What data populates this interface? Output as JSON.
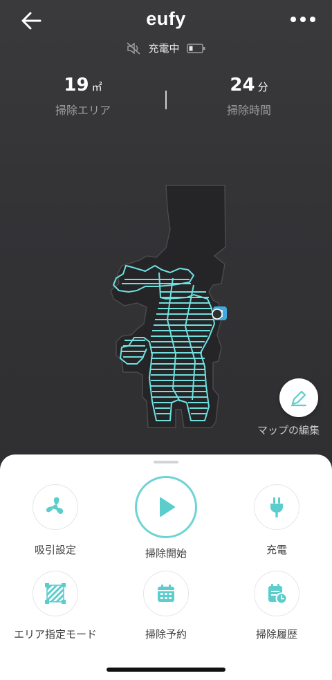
{
  "header": {
    "brand": "eufy",
    "status_text": "充電中"
  },
  "stats": {
    "area": {
      "value": "19",
      "unit": "㎡",
      "label": "掃除エリア"
    },
    "time": {
      "value": "24",
      "unit": "分",
      "label": "掃除時間"
    }
  },
  "map": {
    "edit_label": "マップの編集"
  },
  "actions": [
    {
      "label": "吸引設定",
      "icon": "fan-icon"
    },
    {
      "label": "掃除開始",
      "icon": "play-icon"
    },
    {
      "label": "充電",
      "icon": "plug-icon"
    },
    {
      "label": "エリア指定モード",
      "icon": "area-icon"
    },
    {
      "label": "掃除予約",
      "icon": "calendar-icon"
    },
    {
      "label": "掃除履歴",
      "icon": "history-icon"
    }
  ],
  "colors": {
    "accent": "#5ccdcd",
    "path": "#6ee0de",
    "dock": "#3fa9e0",
    "header_bg": "#353537",
    "map_bg": "#252528"
  }
}
